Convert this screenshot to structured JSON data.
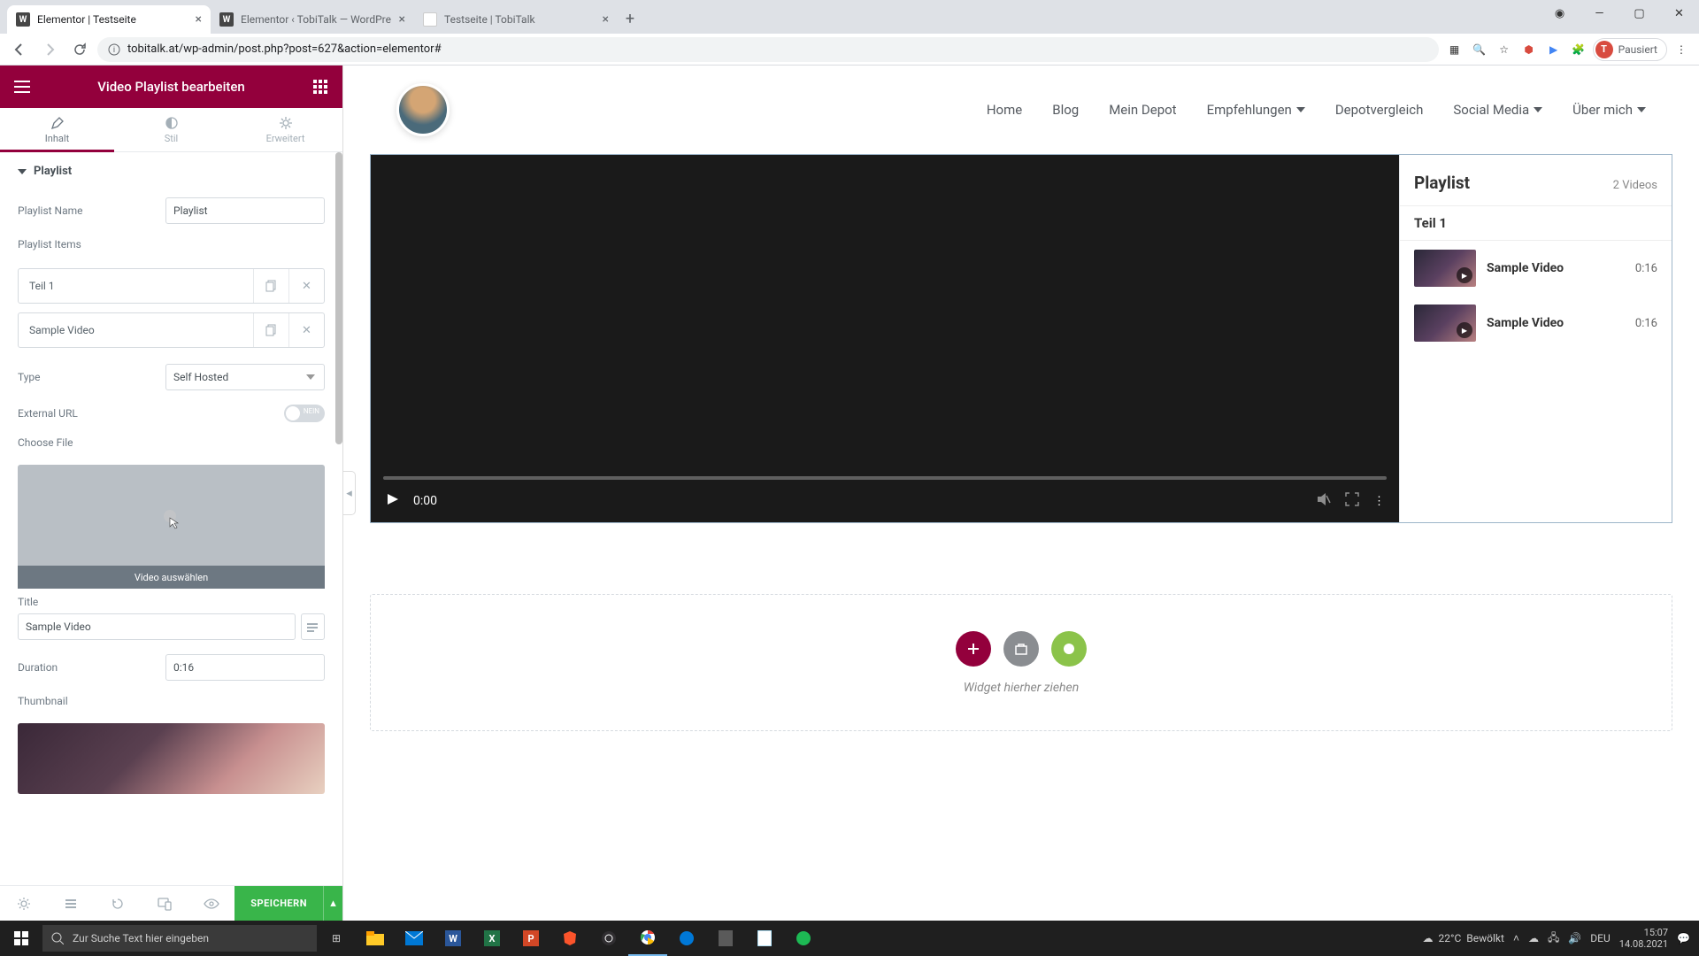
{
  "browser": {
    "tabs": [
      {
        "title": "Elementor | Testseite",
        "active": true
      },
      {
        "title": "Elementor ‹ TobiTalk — WordPre",
        "active": false
      },
      {
        "title": "Testseite | TobiTalk",
        "active": false
      }
    ],
    "url": "tobitalk.at/wp-admin/post.php?post=627&action=elementor#",
    "profile_label": "Pausiert",
    "profile_initial": "T"
  },
  "panel": {
    "header": "Video Playlist bearbeiten",
    "tabs": {
      "content": "Inhalt",
      "style": "Stil",
      "advanced": "Erweitert"
    },
    "section": "Playlist",
    "playlist_name_label": "Playlist Name",
    "playlist_name_value": "Playlist",
    "playlist_items_label": "Playlist Items",
    "items": [
      {
        "title": "Teil 1"
      },
      {
        "title": "Sample Video"
      }
    ],
    "type_label": "Type",
    "type_value": "Self Hosted",
    "external_url_label": "External URL",
    "external_toggle": "NEIN",
    "choose_file_label": "Choose File",
    "choose_file_button": "Video auswählen",
    "title_label": "Title",
    "title_value": "Sample Video",
    "duration_label": "Duration",
    "duration_value": "0:16",
    "thumbnail_label": "Thumbnail",
    "save": "SPEICHERN"
  },
  "site": {
    "nav": [
      "Home",
      "Blog",
      "Mein Depot",
      "Empfehlungen",
      "Depotvergleich",
      "Social Media",
      "Über mich"
    ],
    "nav_has_caret": [
      false,
      false,
      false,
      true,
      false,
      true,
      true
    ]
  },
  "player": {
    "time": "0:00"
  },
  "playlist": {
    "title": "Playlist",
    "count": "2 Videos",
    "section": "Teil 1",
    "videos": [
      {
        "name": "Sample Video",
        "duration": "0:16"
      },
      {
        "name": "Sample Video",
        "duration": "0:16"
      }
    ]
  },
  "drop": {
    "text": "Widget hierher ziehen"
  },
  "taskbar": {
    "search_placeholder": "Zur Suche Text hier eingeben",
    "weather_temp": "22°C",
    "weather_cond": "Bewölkt",
    "lang": "DEU",
    "time": "15:07",
    "date": "14.08.2021"
  }
}
